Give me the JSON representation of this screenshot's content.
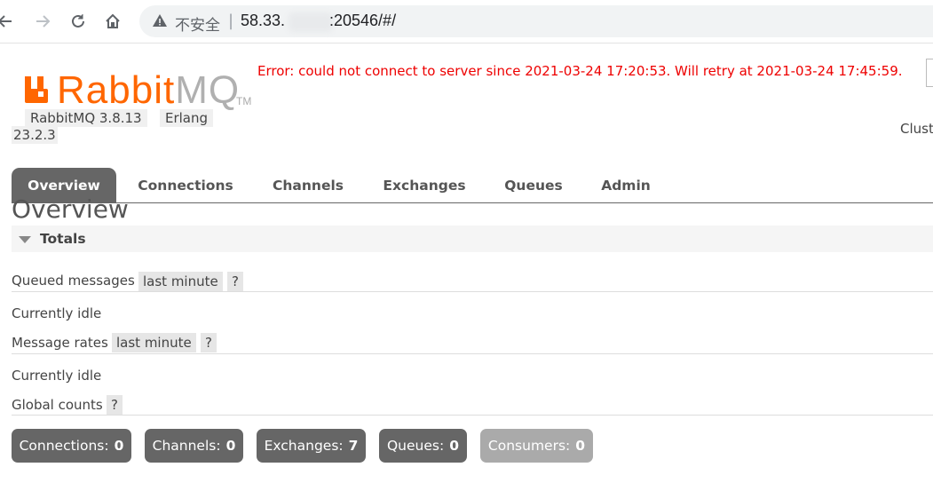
{
  "browser": {
    "address_insecure": "不安全",
    "address_sep": "|",
    "url_prefix": "58.33.",
    "url_suffix": ":20546/#/"
  },
  "header": {
    "logo_rabbit": "Rabbit",
    "logo_mq": "MQ",
    "logo_tm": "TM",
    "rabbitmq_version": "RabbitMQ 3.8.13",
    "erlang_label": "Erlang",
    "erlang_version": "23.2.3",
    "error_message": "Error: could not connect to server since 2021-03-24 17:20:53. Will retry at 2021-03-24 17:45:59.",
    "cluster_label": "Clust"
  },
  "tabs": [
    {
      "label": "Overview",
      "active": true
    },
    {
      "label": "Connections",
      "active": false
    },
    {
      "label": "Channels",
      "active": false
    },
    {
      "label": "Exchanges",
      "active": false
    },
    {
      "label": "Queues",
      "active": false
    },
    {
      "label": "Admin",
      "active": false
    }
  ],
  "main": {
    "title": "Overview",
    "section_title": "Totals",
    "queued_messages": {
      "label": "Queued messages",
      "range": "last minute",
      "help": "?",
      "status": "Currently idle"
    },
    "message_rates": {
      "label": "Message rates",
      "range": "last minute",
      "help": "?",
      "status": "Currently idle"
    },
    "global_counts": {
      "label": "Global counts",
      "help": "?"
    }
  },
  "counts": [
    {
      "label": "Connections:",
      "value": "0",
      "dim": false
    },
    {
      "label": "Channels:",
      "value": "0",
      "dim": false
    },
    {
      "label": "Exchanges:",
      "value": "7",
      "dim": false
    },
    {
      "label": "Queues:",
      "value": "0",
      "dim": false
    },
    {
      "label": "Consumers:",
      "value": "0",
      "dim": true
    }
  ],
  "colors": {
    "brand": "#ff6600",
    "error": "#ee0000",
    "tab_active": "#666666"
  }
}
